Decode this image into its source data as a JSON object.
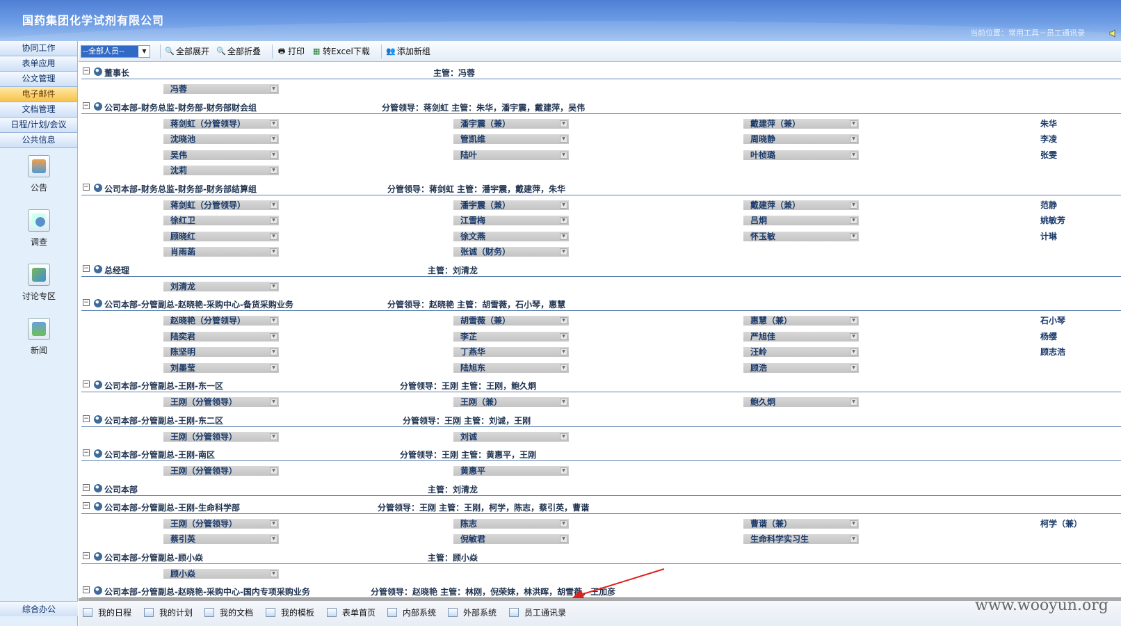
{
  "header": {
    "title": "国药集团化学试剂有限公司",
    "location": "当前位置：常用工具－员工通讯录"
  },
  "sidebar": {
    "items": [
      {
        "label": "协同工作",
        "active": false
      },
      {
        "label": "表单应用",
        "active": false
      },
      {
        "label": "公文管理",
        "active": false
      },
      {
        "label": "电子邮件",
        "active": true
      },
      {
        "label": "文档管理",
        "active": false
      },
      {
        "label": "日程/计划/会议",
        "active": false
      },
      {
        "label": "公共信息",
        "active": false
      }
    ],
    "icons": [
      {
        "label": "公告",
        "icon": "notice-icon"
      },
      {
        "label": "调查",
        "icon": "survey-icon"
      },
      {
        "label": "讨论专区",
        "icon": "forum-icon"
      },
      {
        "label": "新闻",
        "icon": "news-icon"
      }
    ],
    "bottom": "综合办公"
  },
  "toolbar": {
    "filter_value": "--全部人员--",
    "expand_all": "全部展开",
    "collapse_all": "全部折叠",
    "print": "打印",
    "excel": "转Excel下载",
    "add_group": "添加新组"
  },
  "groups": [
    {
      "name": "董事长",
      "manager": "主管：冯蓉",
      "members": [
        [
          "冯蓉"
        ]
      ]
    },
    {
      "name": "公司本部-财务总监-财务部-财务部财会组",
      "manager": "分管领导：蒋剑虹 主管：朱华，潘宇震，戴建萍，吴伟",
      "members": [
        [
          "蒋剑虹（分管领导）",
          "潘宇震（兼）",
          "戴建萍（兼）",
          "朱华"
        ],
        [
          "沈晓池",
          "管凯维",
          "周晓静",
          "李凌"
        ],
        [
          "吴伟",
          "陆叶",
          "叶桢璐",
          "张雯"
        ],
        [
          "沈莉"
        ]
      ]
    },
    {
      "name": "公司本部-财务总监-财务部-财务部结算组",
      "manager": "分管领导：蒋剑虹 主管：潘宇震，戴建萍，朱华",
      "members": [
        [
          "蒋剑虹（分管领导）",
          "潘宇震（兼）",
          "戴建萍（兼）",
          "范静"
        ],
        [
          "徐红卫",
          "江雪梅",
          "吕炯",
          "姚敏芳"
        ],
        [
          "顾晓红",
          "徐文燕",
          "怀玉敏",
          "计琳"
        ],
        [
          "肖雨菡",
          "张诚（财务）"
        ]
      ]
    },
    {
      "name": "总经理",
      "manager": "主管：刘清龙",
      "members": [
        [
          "刘清龙"
        ]
      ]
    },
    {
      "name": "公司本部-分管副总-赵晓艳-采购中心-备货采购业务",
      "manager": "分管领导：赵晓艳 主管：胡雪薇，石小琴，惠慧",
      "members": [
        [
          "赵晓艳（分管领导）",
          "胡雪薇（兼）",
          "惠慧（兼）",
          "石小琴"
        ],
        [
          "陆奕君",
          "李芷",
          "严旭佳",
          "杨缨"
        ],
        [
          "陈坚明",
          "丁燕华",
          "汪岭",
          "顾志浩"
        ],
        [
          "刘墨莹",
          "陆旭东",
          "顾浩"
        ]
      ]
    },
    {
      "name": "公司本部-分管副总-王刚-东一区",
      "manager": "分管领导：王刚 主管：王刚，鲍久炯",
      "members": [
        [
          "王刚（分管领导）",
          "王刚（兼）",
          "鲍久炯"
        ]
      ]
    },
    {
      "name": "公司本部-分管副总-王刚-东二区",
      "manager": "分管领导：王刚 主管：刘诚，王刚",
      "members": [
        [
          "王刚（分管领导）",
          "刘诚"
        ]
      ]
    },
    {
      "name": "公司本部-分管副总-王刚-南区",
      "manager": "分管领导：王刚 主管：黄惠平，王刚",
      "members": [
        [
          "王刚（分管领导）",
          "黄惠平"
        ]
      ]
    },
    {
      "name": "公司本部",
      "manager": "主管：刘清龙",
      "members": []
    },
    {
      "name": "公司本部-分管副总-王刚-生命科学部",
      "manager": "分管领导：王刚 主管：王刚，柯学，陈志，蔡引英，曹谐",
      "members": [
        [
          "王刚（分管领导）",
          "陈志",
          "曹谐（兼）",
          "柯学（兼）"
        ],
        [
          "蔡引英",
          "倪敏君",
          "生命科学实习生"
        ]
      ]
    },
    {
      "name": "公司本部-分管副总-顾小焱",
      "manager": "主管：顾小焱",
      "members": [
        [
          "顾小焱"
        ]
      ]
    },
    {
      "name": "公司本部-分管副总-赵晓艳-采购中心-国内专项采购业务",
      "manager": "分管领导：赵晓艳 主管：林刚，倪荣妹，林洪晖，胡雪薇，王加彦",
      "members": []
    }
  ],
  "taskbar": [
    {
      "label": "我的日程"
    },
    {
      "label": "我的计划"
    },
    {
      "label": "我的文档"
    },
    {
      "label": "我的模板"
    },
    {
      "label": "表单首页"
    },
    {
      "label": "内部系统"
    },
    {
      "label": "外部系统"
    },
    {
      "label": "员工通讯录"
    }
  ],
  "watermark": "www.wooyun.org"
}
